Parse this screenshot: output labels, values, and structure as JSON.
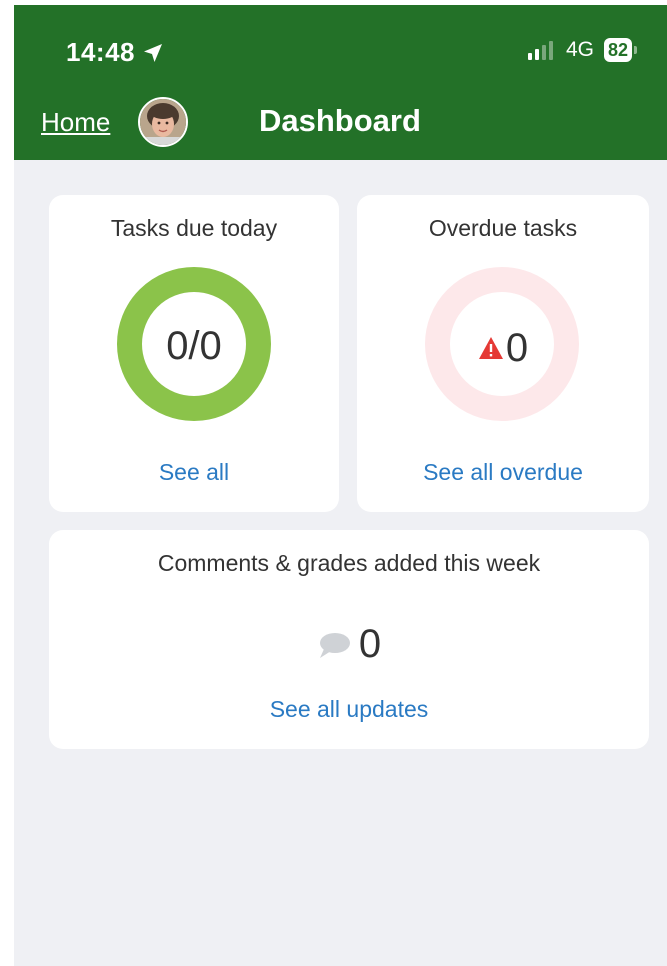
{
  "status_bar": {
    "time": "14:48",
    "network": "4G",
    "battery": "82"
  },
  "nav": {
    "home_label": "Home",
    "title": "Dashboard"
  },
  "cards": {
    "tasks_due": {
      "title": "Tasks due today",
      "value": "0/0",
      "link": "See all"
    },
    "overdue": {
      "title": "Overdue tasks",
      "value": "0",
      "link": "See all overdue"
    },
    "comments": {
      "title": "Comments & grades added this week",
      "value": "0",
      "link": "See all updates"
    }
  },
  "colors": {
    "header": "#237128",
    "background": "#eff0f4",
    "link": "#2a7ac3",
    "ring_green": "#8bc34a",
    "ring_pink": "#fde8ea",
    "warning_red": "#e53935"
  },
  "icons": {
    "location": "location-arrow-icon",
    "signal": "signal-icon",
    "avatar": "avatar",
    "warning": "warning-icon",
    "comment": "comment-icon"
  }
}
